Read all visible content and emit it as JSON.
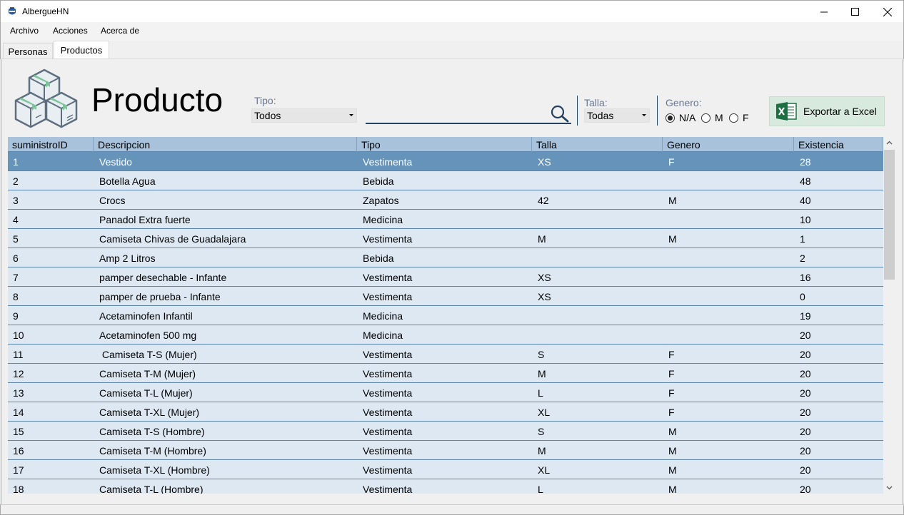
{
  "window": {
    "title": "AlbergueHN"
  },
  "menu": {
    "items": [
      "Archivo",
      "Acciones",
      "Acerca de"
    ]
  },
  "tabs": [
    {
      "label": "Personas",
      "active": false
    },
    {
      "label": "Productos",
      "active": true
    }
  ],
  "header": {
    "title": "Producto"
  },
  "filters": {
    "tipo": {
      "label": "Tipo:",
      "value": "Todos"
    },
    "search": {
      "value": ""
    },
    "talla": {
      "label": "Talla:",
      "value": "Todas"
    },
    "genero": {
      "label": "Genero:",
      "options": [
        "N/A",
        "M",
        "F"
      ],
      "selected": "N/A"
    }
  },
  "export_button": {
    "label": "Exportar a Excel"
  },
  "colors": {
    "selected_row": "#6593b9",
    "row_bg": "#dde8f2",
    "header_bg": "#a7c2da",
    "accent": "#24415e",
    "excel_green": "#1d6f42"
  },
  "table": {
    "columns": [
      "suministroID",
      "Descripcion",
      "Tipo",
      "Talla",
      "Genero",
      "Existencia"
    ],
    "rows": [
      [
        "1",
        "Vestido",
        "Vestimenta",
        "XS",
        "F",
        "28"
      ],
      [
        "2",
        "Botella Agua",
        "Bebida",
        "",
        "",
        "48"
      ],
      [
        "3",
        "Crocs",
        "Zapatos",
        "42",
        "M",
        "40"
      ],
      [
        "4",
        "Panadol Extra fuerte",
        "Medicina",
        "",
        "",
        "10"
      ],
      [
        "5",
        "Camiseta Chivas de Guadalajara",
        "Vestimenta",
        "M",
        "M",
        "1"
      ],
      [
        "6",
        "Amp 2 Litros",
        "Bebida",
        "",
        "",
        "2"
      ],
      [
        "7",
        "pamper desechable - Infante",
        "Vestimenta",
        "XS",
        "",
        "16"
      ],
      [
        "8",
        "pamper de prueba - Infante",
        "Vestimenta",
        "XS",
        "",
        "0"
      ],
      [
        "9",
        "Acetaminofen Infantil",
        "Medicina",
        "",
        "",
        "19"
      ],
      [
        "10",
        "Acetaminofen 500 mg",
        "Medicina",
        "",
        "",
        "20"
      ],
      [
        "11",
        " Camiseta T-S (Mujer)",
        "Vestimenta",
        "S",
        "F",
        "20"
      ],
      [
        "12",
        "Camiseta T-M (Mujer)",
        "Vestimenta",
        "M",
        "F",
        "20"
      ],
      [
        "13",
        "Camiseta T-L (Mujer)",
        "Vestimenta",
        "L",
        "F",
        "20"
      ],
      [
        "14",
        "Camiseta T-XL (Mujer)",
        "Vestimenta",
        "XL",
        "F",
        "20"
      ],
      [
        "15",
        "Camiseta T-S (Hombre)",
        "Vestimenta",
        "S",
        "M",
        "20"
      ],
      [
        "16",
        "Camiseta T-M (Hombre)",
        "Vestimenta",
        "M",
        "M",
        "20"
      ],
      [
        "17",
        "Camiseta T-XL (Hombre)",
        "Vestimenta",
        "XL",
        "M",
        "20"
      ],
      [
        "18",
        "Camiseta T-L (Hombre)",
        "Vestimenta",
        "L",
        "M",
        "20"
      ]
    ],
    "selected_row": 0
  }
}
